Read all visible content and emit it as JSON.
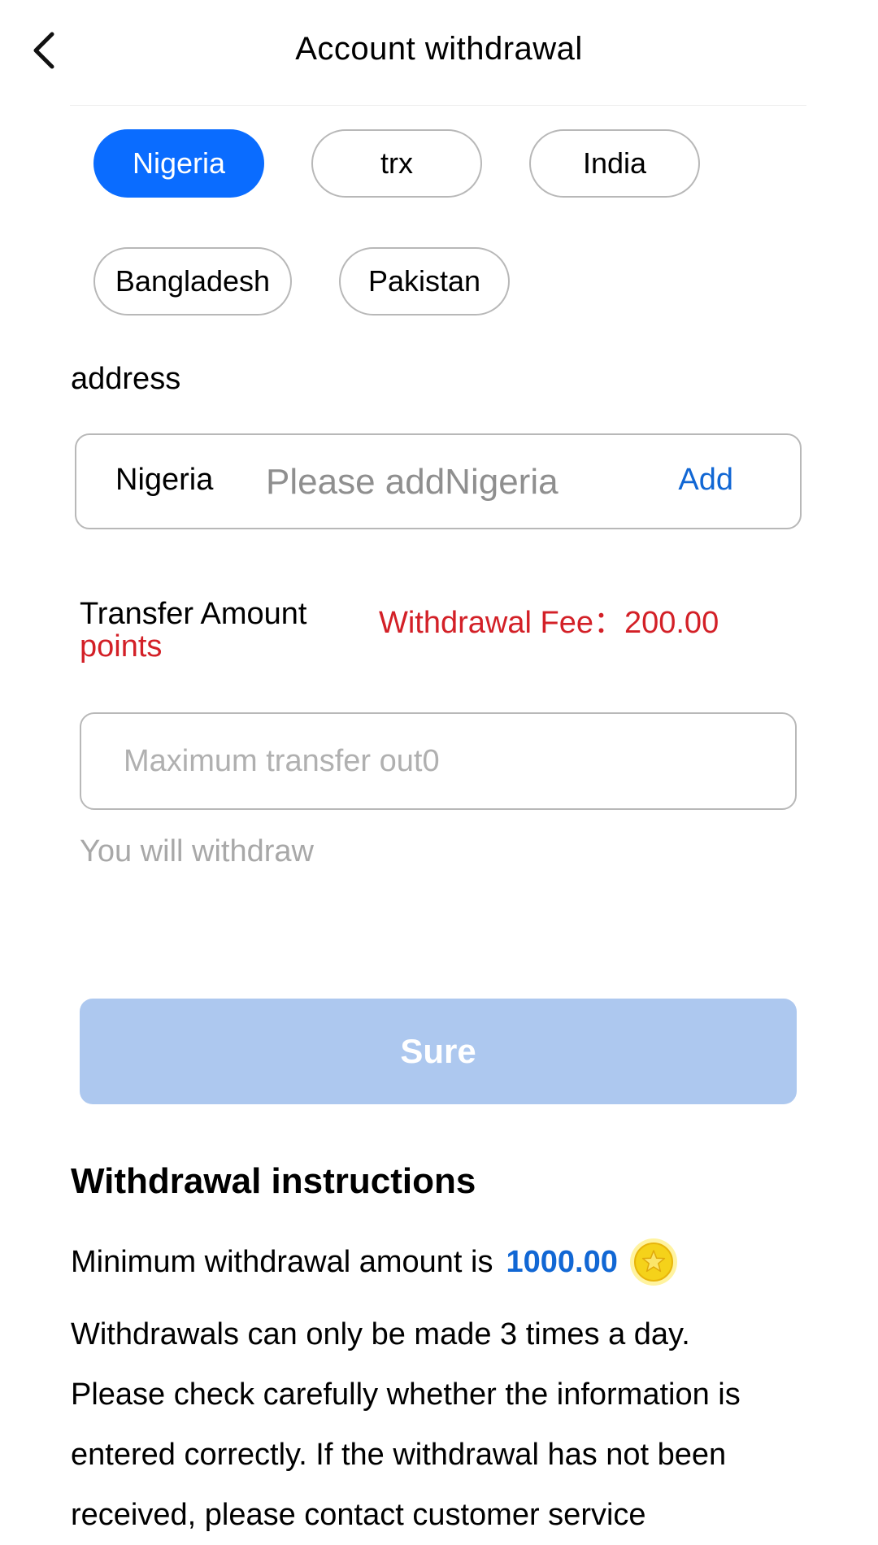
{
  "header": {
    "title": "Account withdrawal"
  },
  "methods": [
    {
      "label": "Nigeria",
      "active": true
    },
    {
      "label": "trx",
      "active": false
    },
    {
      "label": "India",
      "active": false
    },
    {
      "label": "Bangladesh",
      "active": false
    },
    {
      "label": "Pakistan",
      "active": false
    }
  ],
  "address": {
    "label": "address",
    "method": "Nigeria",
    "placeholder": "Please addNigeria",
    "add_label": "Add"
  },
  "transfer": {
    "label": "Transfer Amount",
    "fee_text": "Withdrawal Fee：200.00",
    "unit": "points",
    "placeholder": "Maximum transfer out0",
    "preview": "You will withdraw"
  },
  "submit": {
    "label": "Sure",
    "color": "#adc8ef"
  },
  "instructions": {
    "title": "Withdrawal instructions",
    "min_prefix": "Minimum withdrawal amount is",
    "min_amount": "1000.00",
    "coin_icon": "gold-coin-star-icon",
    "lines": [
      "Withdrawals can only be made 3 times a day.",
      "Please check carefully whether the information is",
      "entered correctly. If the withdrawal has not been",
      "received, please contact customer service"
    ]
  },
  "colors": {
    "accent": "#0a6cff",
    "link": "#1167d4",
    "fee": "#d32027"
  }
}
